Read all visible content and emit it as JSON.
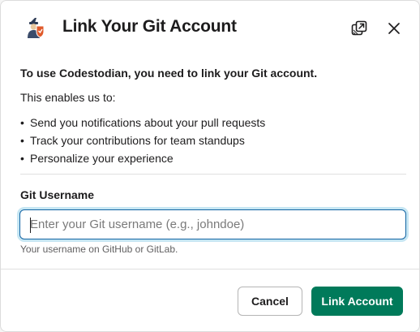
{
  "header": {
    "title": "Link Your Git Account",
    "app_icon": "codestodian-app-icon",
    "popout_icon": "popout-icon",
    "close_icon": "close-icon"
  },
  "body": {
    "intro": "To use Codestodian, you need to link your Git account.",
    "enables": "This enables us to:",
    "bullets": [
      "Send you notifications about your pull requests",
      "Track your contributions for team standups",
      "Personalize your experience"
    ]
  },
  "form": {
    "label": "Git Username",
    "value": "",
    "placeholder": "Enter your Git username (e.g., johndoe)",
    "hint": "Your username on GitHub or GitLab."
  },
  "footer": {
    "cancel_label": "Cancel",
    "submit_label": "Link Account"
  },
  "colors": {
    "primary": "#007a5a",
    "focus": "#1264a3"
  }
}
